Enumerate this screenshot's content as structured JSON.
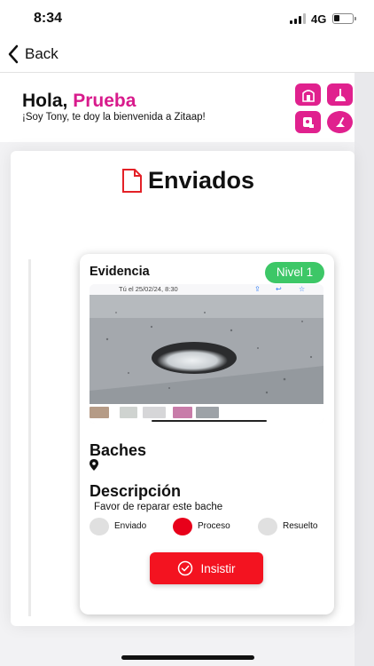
{
  "status_bar": {
    "time": "8:34",
    "network": "4G",
    "battery_level": 0.3
  },
  "nav": {
    "back_label": "Back"
  },
  "header": {
    "greeting": "Hola,",
    "user_name": "Prueba",
    "welcome": "¡Soy Tony, te doy la bienvenida a Zitaap!"
  },
  "logo": {
    "tiles": [
      "doorway-icon",
      "plunger-icon",
      "toilet-paper-icon",
      "sweeping-icon"
    ]
  },
  "page": {
    "title": "Enviados"
  },
  "report": {
    "evidence_label": "Evidencia",
    "level": "Nivel 1",
    "message_date": "Tú el 25/02/24, 8:30",
    "category": "Baches",
    "description_label": "Descripción",
    "description": "Favor de reparar este bache",
    "statuses": [
      {
        "label": "Enviado",
        "active": false
      },
      {
        "label": "Proceso",
        "active": true
      },
      {
        "label": "Resuelto",
        "active": false
      }
    ],
    "action_label": "Insistir"
  },
  "colors": {
    "brand": "#d81b8c",
    "logo_tile": "#e0218e",
    "accent_red": "#f31320",
    "level_green": "#3dc767"
  }
}
